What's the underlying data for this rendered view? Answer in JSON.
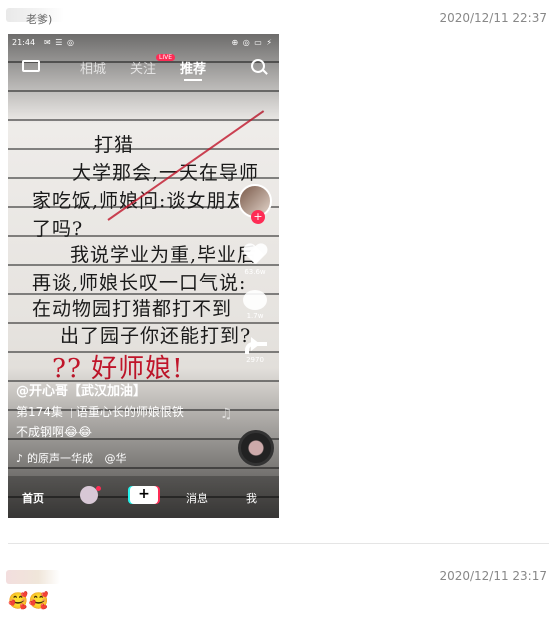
{
  "message1": {
    "sender": "老爹)",
    "timestamp": "2020/12/11 22:37"
  },
  "phone": {
    "status_time": "21:44",
    "status_icons": "✉ ☰ ◎",
    "status_right": "⊕ ◎ ▭ ⚡",
    "nav_tabs": [
      "相城",
      "关注",
      "推荐"
    ],
    "live_badge": "LIVE",
    "handwriting_lines": [
      "打猎",
      "大学那会,一天在导师",
      "家吃饭,师娘问:谈女朋友",
      "了吗?",
      "我说学业为重,毕业后",
      "再谈,师娘长叹一口气说:",
      "在动物园打猎都打不到",
      "出了园子你还能打到?",
      "?? 好师娘!"
    ],
    "actions": {
      "likes": "63.6w",
      "comments": "1.7w",
      "shares": "2970"
    },
    "creator_handle": "@开心哥【武汉加油】",
    "episode": "第174集",
    "caption_part1": "语重心长的师娘恨铁",
    "caption_part2": "不成钢啊😂😂",
    "music_note": "♪",
    "music": "的原声一华成",
    "music_author": "@华",
    "floating_note": "♫",
    "bottom_nav": {
      "home": "首页",
      "plus": "+",
      "messages": "消息",
      "me": "我"
    }
  },
  "message2": {
    "timestamp": "2020/12/11 23:17",
    "emojis": "🥰🥰"
  }
}
